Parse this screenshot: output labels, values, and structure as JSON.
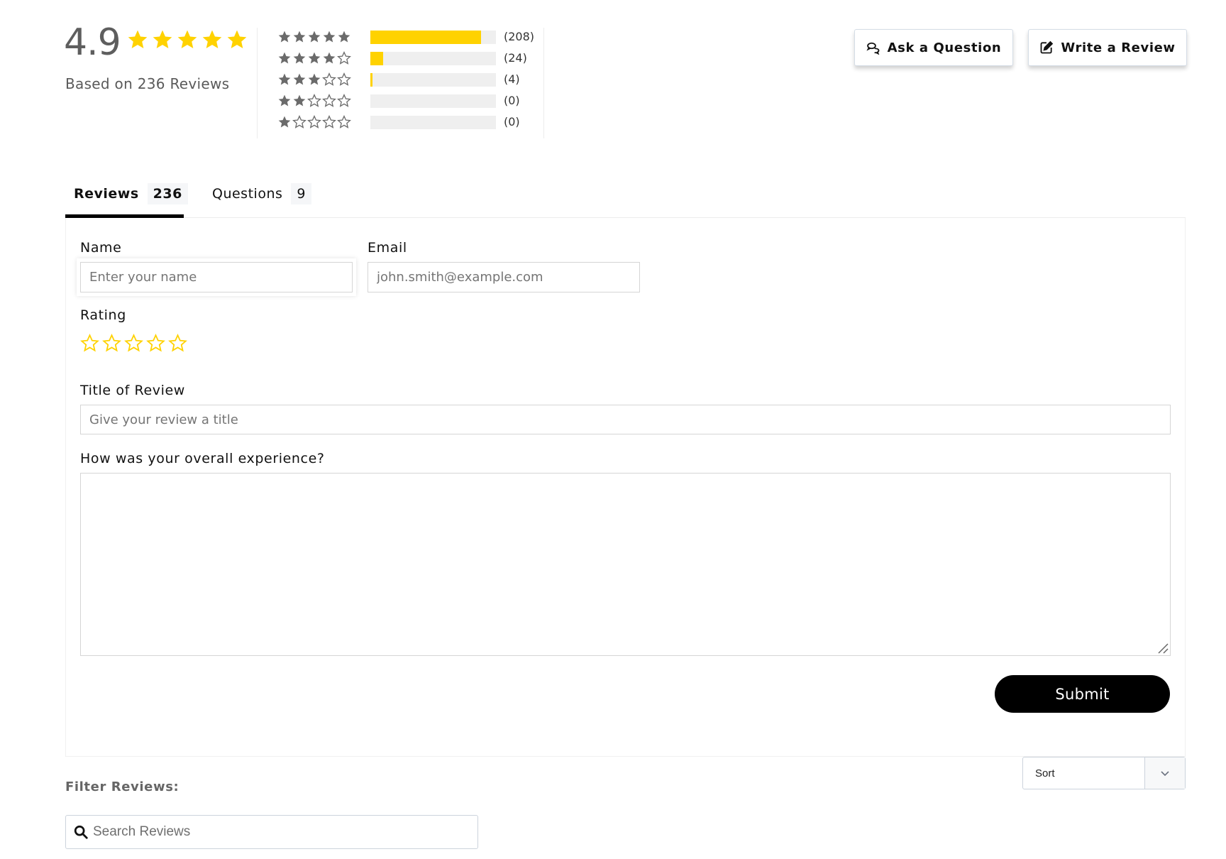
{
  "summary": {
    "average": "4.9",
    "average_stars": 5,
    "based_on": "Based on 236 Reviews",
    "star_color": "#FFD200",
    "histogram": [
      {
        "stars": 5,
        "count": 208,
        "count_label": "(208)",
        "fraction": 0.881
      },
      {
        "stars": 4,
        "count": 24,
        "count_label": "(24)",
        "fraction": 0.102
      },
      {
        "stars": 3,
        "count": 4,
        "count_label": "(4)",
        "fraction": 0.017
      },
      {
        "stars": 2,
        "count": 0,
        "count_label": "(0)",
        "fraction": 0
      },
      {
        "stars": 1,
        "count": 0,
        "count_label": "(0)",
        "fraction": 0
      }
    ]
  },
  "actions": {
    "ask_question": {
      "label": "Ask a Question",
      "icon": "chat-bubbles-icon"
    },
    "write_review": {
      "label": "Write a Review",
      "icon": "edit-square-icon"
    }
  },
  "tabs": [
    {
      "label": "Reviews",
      "count": "236",
      "active": true
    },
    {
      "label": "Questions",
      "count": "9",
      "active": false
    }
  ],
  "form": {
    "name_label": "Name",
    "name_placeholder": "Enter your name",
    "email_label": "Email",
    "email_placeholder": "john.smith@example.com",
    "rating_label": "Rating",
    "rating_value": 0,
    "rating_max": 5,
    "title_label": "Title of Review",
    "title_placeholder": "Give your review a title",
    "experience_label": "How was your overall experience?",
    "experience_value": "",
    "submit_label": "Submit"
  },
  "sort": {
    "selected": "Sort"
  },
  "filter": {
    "label": "Filter Reviews:",
    "search_placeholder": "Search Reviews"
  }
}
